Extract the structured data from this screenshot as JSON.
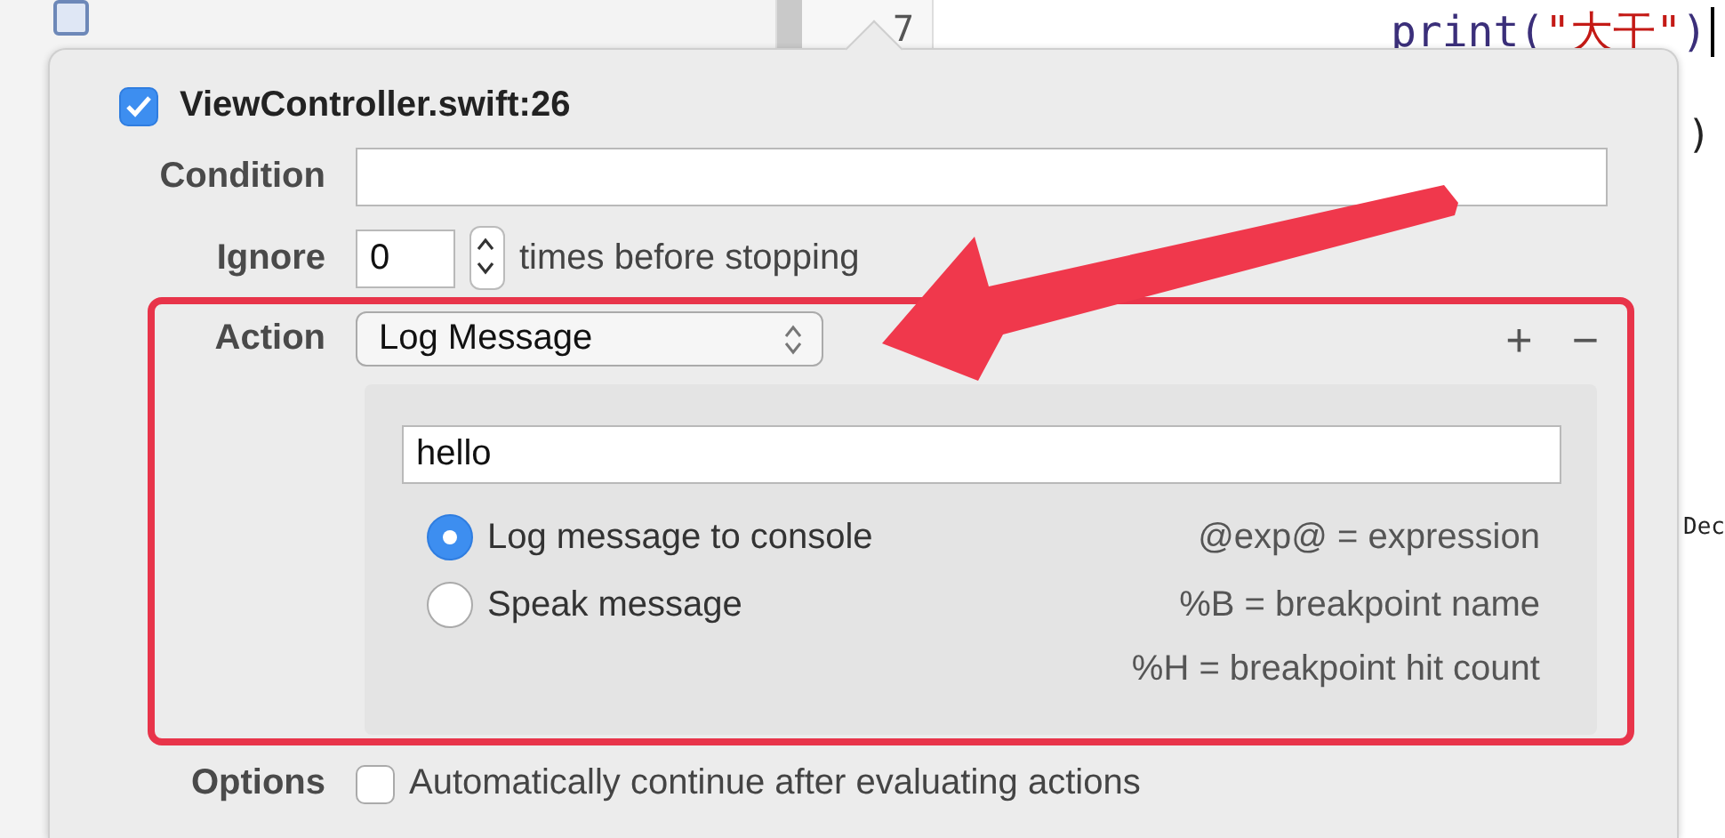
{
  "editor": {
    "line_number": "7",
    "code_line": [
      {
        "kind": "function",
        "text": "print("
      },
      {
        "kind": "string",
        "text": "\"大干\""
      },
      {
        "kind": "function",
        "text": ")"
      }
    ],
    "fragments": [
      ")",
      "Dec"
    ]
  },
  "breakpoint": {
    "title": "ViewController.swift:26",
    "enabled": true,
    "condition": {
      "label": "Condition"
    },
    "ignore": {
      "label": "Ignore",
      "value": "0",
      "suffix": "times before stopping"
    },
    "action": {
      "label": "Action",
      "value": "Log Message",
      "add": "+",
      "remove": "−",
      "message": "hello",
      "outputs": [
        {
          "label": "Log message to console",
          "selected": true
        },
        {
          "label": "Speak message",
          "selected": false
        }
      ],
      "hints": [
        "@exp@ = expression",
        "%B = breakpoint name",
        "%H = breakpoint hit count"
      ]
    },
    "options": {
      "label": "Options",
      "text": "Automatically continue after evaluating actions",
      "checked": false
    }
  }
}
